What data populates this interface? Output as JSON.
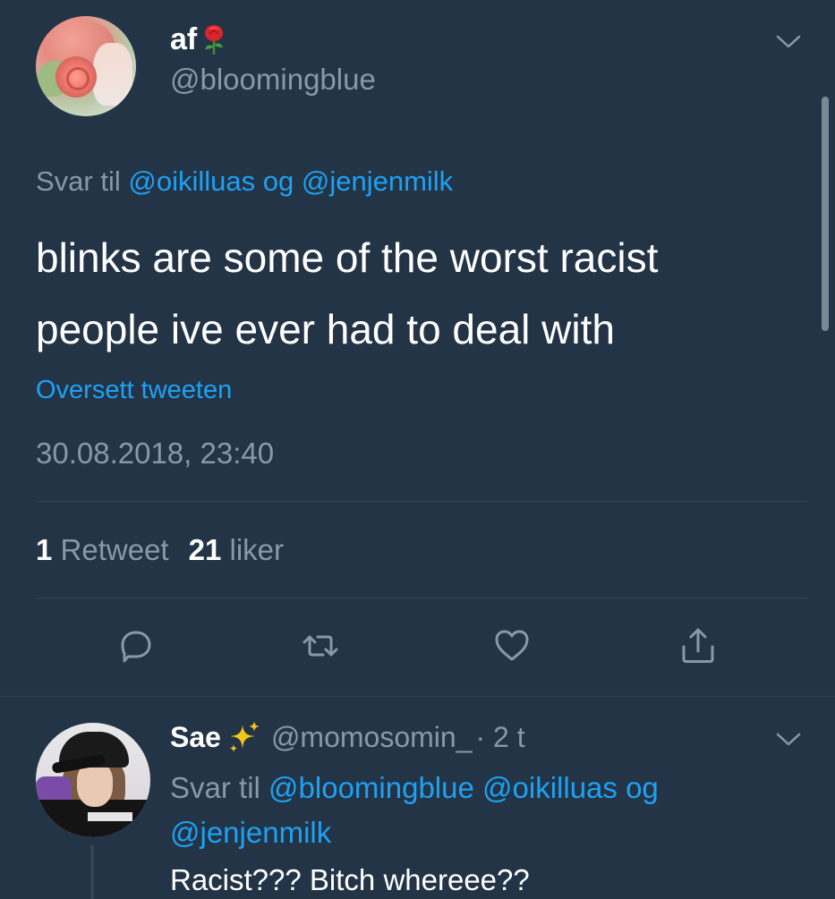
{
  "main_tweet": {
    "display_name": "af",
    "name_emoji": "rose-icon",
    "handle": "@bloomingblue",
    "reply_prefix": "Svar til",
    "reply_user_1": "@oikilluas",
    "reply_joiner": "og",
    "reply_user_2": "@jenjenmilk",
    "text_line_1": "blinks are some of the worst racist",
    "text_line_2": "people ive ever had to deal with",
    "translate_label": "Oversett tweeten",
    "timestamp": "30.08.2018, 23:40",
    "retweet_count": "1",
    "retweet_label": "Retweet",
    "like_count": "21",
    "like_label": "liker"
  },
  "actions": [
    "reply-icon",
    "retweet-icon",
    "like-icon",
    "share-icon"
  ],
  "reply_tweet": {
    "display_name": "Sae",
    "name_emoji": "sparkles-icon",
    "handle": "@momosomin_",
    "time": "· 2 t",
    "reply_prefix": "Svar til",
    "reply_user_1": "@bloomingblue",
    "reply_user_2": "@oikilluas",
    "reply_joiner": "og",
    "reply_user_3": "@jenjenmilk",
    "text": "Racist??? Bitch whereee??"
  },
  "colors": {
    "background": "#243447",
    "text": "#ffffff",
    "secondary": "#8899a6",
    "link": "#1da1f2",
    "divider": "#38444d"
  }
}
